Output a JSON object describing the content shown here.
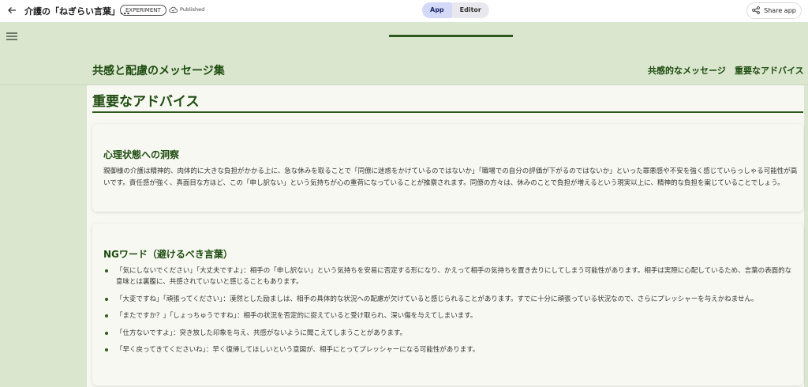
{
  "topbar": {
    "title": "介護の「ねぎらい言葉」...",
    "badge": "EXPERIMENT",
    "status": "Published",
    "toggle": {
      "app": "App",
      "editor": "Editor",
      "active": "App"
    },
    "share": "Share app"
  },
  "site": {
    "title": "共感と配慮のメッセージ集",
    "nav": [
      "共感的なメッセージ",
      "重要なアドバイス"
    ]
  },
  "section": {
    "title": "重要なアドバイス"
  },
  "card1": {
    "heading": "心理状態への洞察",
    "body": "親御様の介護は精神的、肉体的に大きな負担がかかる上に、急な休みを取ることで「同僚に迷惑をかけているのではないか」「職場での自分の評価が下がるのではないか」といった罪悪感や不安を強く感じていらっしゃる可能性が高いです。責任感が強く、真面目な方ほど、この「申し訳ない」という気持ちが心の重荷になっていることが推察されます。同僚の方々は、休みのことで負担が増えるという現実以上に、精神的な負担を案じていることでしょう。"
  },
  "card2": {
    "heading": "NGワード（避けるべき言葉）",
    "items": [
      "「気にしないでください」「大丈夫ですよ」：相手の「申し訳ない」という気持ちを安易に否定する形になり、かえって相手の気持ちを置き去りにしてしまう可能性があります。相手は実際に心配しているため、言葉の表面的な意味とは裏腹に、共感されていないと感じることもあります。",
      "「大変ですね」「頑張ってください」：漠然とした励ましは、相手の具体的な状況への配慮が欠けていると感じられることがあります。すでに十分に頑張っている状況なので、さらにプレッシャーを与えかねません。",
      "「またですか？」「しょっちゅうですね」：相手の状況を否定的に捉えていると受け取られ、深い傷を与えてしまいます。",
      "「仕方ないですよ」：突き放した印象を与え、共感がないように聞こえてしまうことがあります。",
      "「早く戻ってきてくださいね」：早く復帰してほしいという意図が、相手にとってプレッシャーになる可能性があります。"
    ]
  },
  "colors": {
    "accent": "#1e4d10",
    "band": "#dbe6cf",
    "background": "#f8f8f2"
  }
}
